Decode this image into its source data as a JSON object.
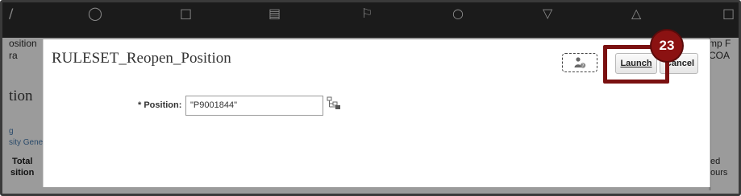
{
  "background": {
    "left_labels": [
      "osition",
      "ra",
      "tion",
      "g",
      "sity Gene",
      "Total",
      "sition"
    ],
    "right_labels": [
      "mp F",
      "COA",
      "ed",
      "ours"
    ],
    "top_icons": [
      "person-icon",
      "upload-icon",
      "list-icon",
      "flag-icon",
      "money-icon",
      "shield-icon",
      "chart-icon"
    ]
  },
  "dialog": {
    "title": "RULESET_Reopen_Position",
    "launch_label": "Launch",
    "cancel_label": "Cancel",
    "field": {
      "label": "* Position:",
      "value": "\"P9001844\""
    }
  },
  "callout": {
    "step": "23",
    "color": "#8b1212"
  }
}
